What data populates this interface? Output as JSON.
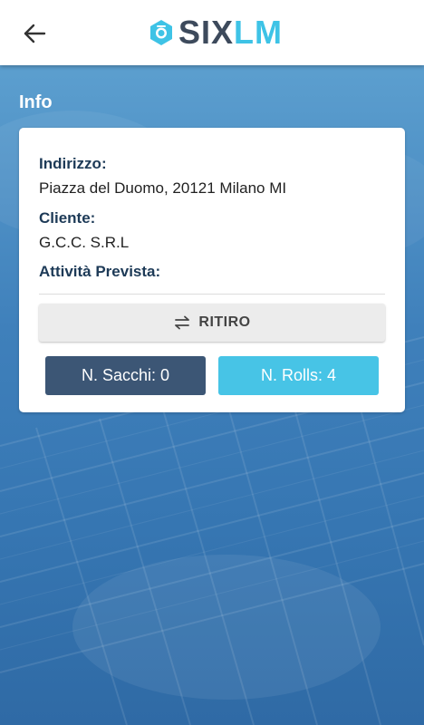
{
  "header": {
    "back_icon": "arrow-left-icon",
    "logo_prefix": "SIX",
    "logo_suffix": "LM",
    "logo_color_dark": "#3d4a5c",
    "logo_color_accent": "#3ec3e6"
  },
  "section": {
    "title": "Info"
  },
  "card": {
    "address_label": "Indirizzo:",
    "address_value": "Piazza del Duomo, 20121 Milano MI",
    "client_label": "Cliente:",
    "client_value": "G.C.C. S.R.L",
    "activity_label": "Attività Prevista:",
    "activity_button": {
      "icon": "swap-arrows-icon",
      "label": "RITIRO"
    },
    "sacchi": {
      "label": "N. Sacchi: 0",
      "color": "#3c5675"
    },
    "rolls": {
      "label": "N. Rolls: 4",
      "color": "#47c4e6"
    }
  }
}
